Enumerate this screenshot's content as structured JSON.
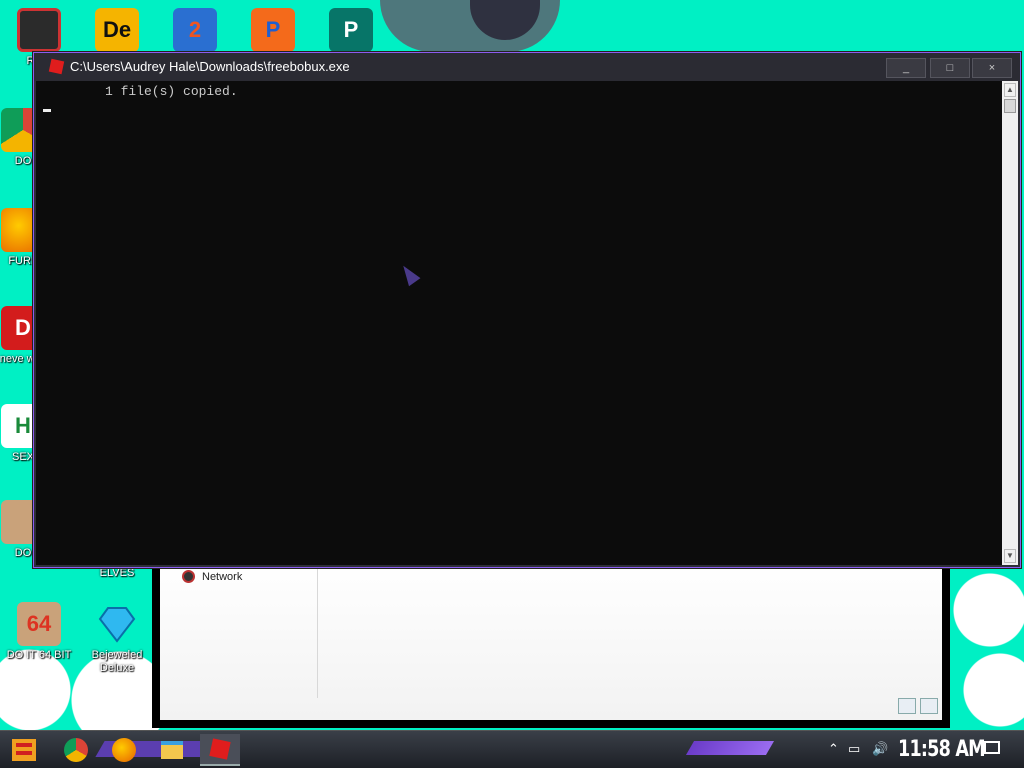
{
  "desktop": {
    "icons": [
      {
        "label": "Recy",
        "icon": "recycle-bin-icon"
      },
      {
        "label": "",
        "icon": "daemon-tools-icon"
      },
      {
        "label": "",
        "icon": "app-2-icon"
      },
      {
        "label": "",
        "icon": "app-p-icon"
      },
      {
        "label": "",
        "icon": "publisher-icon"
      },
      {
        "label": "DO",
        "icon": "chrome-icon"
      },
      {
        "label": "FURF",
        "icon": "firefox-icon"
      },
      {
        "label": "neve why",
        "icon": "app-dc-icon"
      },
      {
        "label": "SEX",
        "icon": "app-h-icon"
      },
      {
        "label": "DO",
        "icon": "portrait-icon"
      },
      {
        "label": "ELVES",
        "icon": "elves-icon"
      },
      {
        "label": "DO IT 64 BIT",
        "icon": "portrait-64-icon"
      },
      {
        "label": "Bejeweled Deluxe",
        "icon": "bejeweled-icon"
      }
    ]
  },
  "explorer": {
    "nav_item": "Network"
  },
  "console": {
    "title": "C:\\Users\\Audrey Hale\\Downloads\\freebobux.exe",
    "output_line": "1 file(s) copied.",
    "minimize_label": "_",
    "maximize_label": "□",
    "close_label": "×"
  },
  "taskbar": {
    "pinned": [
      "start-icon",
      "chrome-icon",
      "firefox-icon",
      "file-explorer-icon",
      "roblox-icon"
    ],
    "clock": "11:58 AM"
  },
  "colors": {
    "wallpaper": "#00f0c4",
    "console_bg": "#0c0c0c",
    "accent": "#8a5cf0"
  }
}
